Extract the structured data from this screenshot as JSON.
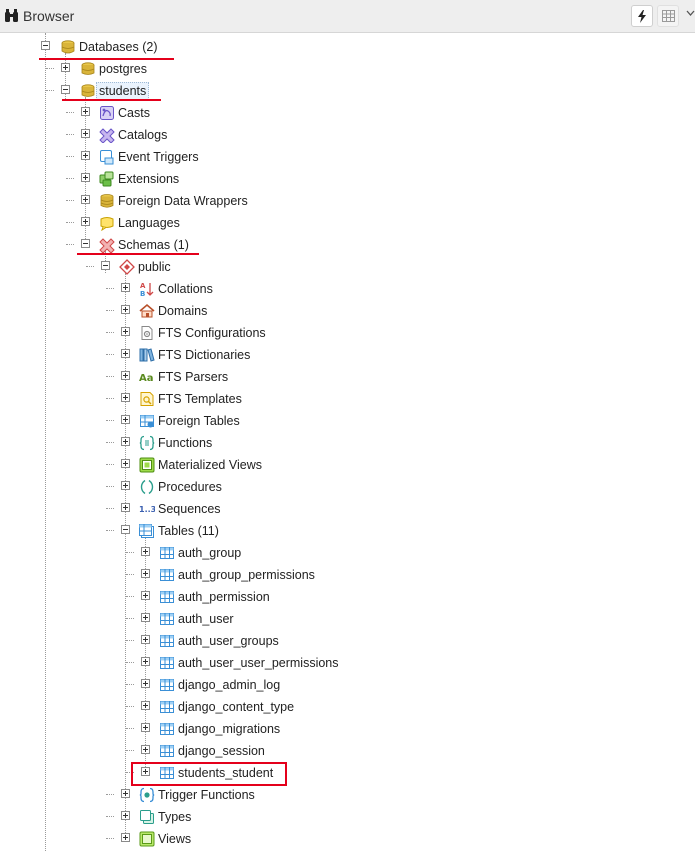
{
  "header": {
    "title": "Browser",
    "buttons": [
      "lightning-icon",
      "table-grid-icon",
      "chevron-down-icon"
    ]
  },
  "tree": {
    "databases_label": "Databases (2)",
    "postgres_label": "postgres",
    "students_label": "students",
    "students_children": [
      {
        "label": "Casts",
        "icon": "casts-icon"
      },
      {
        "label": "Catalogs",
        "icon": "catalogs-icon"
      },
      {
        "label": "Event Triggers",
        "icon": "event-triggers-icon"
      },
      {
        "label": "Extensions",
        "icon": "extensions-icon"
      },
      {
        "label": "Foreign Data Wrappers",
        "icon": "foreign-data-wrappers-icon"
      },
      {
        "label": "Languages",
        "icon": "languages-icon"
      }
    ],
    "schemas_label": "Schemas (1)",
    "public_label": "public",
    "public_children": [
      {
        "label": "Collations",
        "icon": "collations-icon"
      },
      {
        "label": "Domains",
        "icon": "domains-icon"
      },
      {
        "label": "FTS Configurations",
        "icon": "fts-configurations-icon"
      },
      {
        "label": "FTS Dictionaries",
        "icon": "fts-dictionaries-icon"
      },
      {
        "label": "FTS Parsers",
        "icon": "fts-parsers-icon"
      },
      {
        "label": "FTS Templates",
        "icon": "fts-templates-icon"
      },
      {
        "label": "Foreign Tables",
        "icon": "foreign-tables-icon"
      },
      {
        "label": "Functions",
        "icon": "functions-icon"
      },
      {
        "label": "Materialized Views",
        "icon": "materialized-views-icon"
      },
      {
        "label": "Procedures",
        "icon": "procedures-icon"
      },
      {
        "label": "Sequences",
        "icon": "sequences-icon"
      }
    ],
    "tables_label": "Tables (11)",
    "tables": [
      "auth_group",
      "auth_group_permissions",
      "auth_permission",
      "auth_user",
      "auth_user_groups",
      "auth_user_user_permissions",
      "django_admin_log",
      "django_content_type",
      "django_migrations",
      "django_session",
      "students_student"
    ],
    "after_tables": [
      {
        "label": "Trigger Functions",
        "icon": "trigger-functions-icon"
      },
      {
        "label": "Types",
        "icon": "types-icon"
      },
      {
        "label": "Views",
        "icon": "views-icon"
      }
    ],
    "sequences_icon_text": "1..3",
    "fts_parsers_icon_text": "Aa"
  },
  "colors": {
    "annotation_red": "#e4001b",
    "header_bg": "#eeeeee",
    "database_gold": "#c9a227",
    "table_blue": "#3a8fd6"
  }
}
